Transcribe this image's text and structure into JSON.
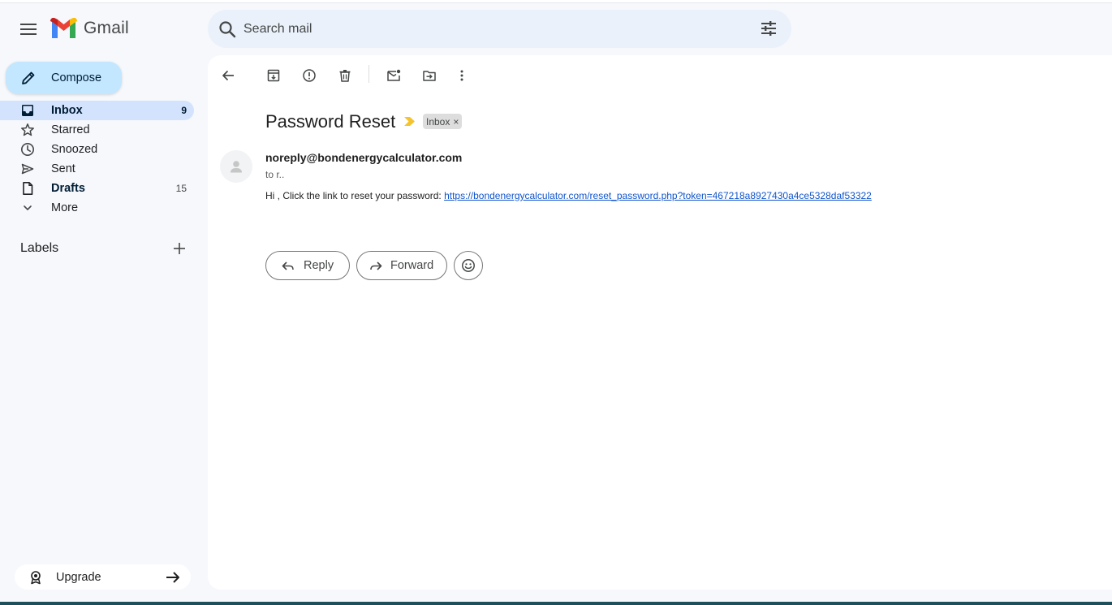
{
  "app": {
    "name": "Gmail",
    "colors": {
      "accent": "#c2e7ff",
      "nav_active": "#d3e3fd",
      "link": "#1155cc",
      "importance": "#f4c430"
    }
  },
  "header": {
    "menu_icon": "hamburger-menu-icon",
    "logo_text": "Gmail",
    "search": {
      "placeholder": "Search mail",
      "value": ""
    }
  },
  "sidebar": {
    "compose_label": "Compose",
    "items": [
      {
        "label": "Inbox",
        "count": "9",
        "icon": "inbox-icon"
      },
      {
        "label": "Starred",
        "count": "",
        "icon": "star-icon"
      },
      {
        "label": "Snoozed",
        "count": "",
        "icon": "clock-icon"
      },
      {
        "label": "Sent",
        "count": "",
        "icon": "send-icon"
      },
      {
        "label": "Drafts",
        "count": "15",
        "icon": "draft-icon"
      },
      {
        "label": "More",
        "count": "",
        "icon": "chevron-down-icon"
      }
    ],
    "labels_heading": "Labels",
    "upgrade_label": "Upgrade"
  },
  "message": {
    "subject": "Password Reset",
    "chip_label": "Inbox",
    "chip_close": "×",
    "sender": "noreply@bondenergycalculator.com",
    "to": "to r..",
    "body_greeting": "Hi ",
    "body_name": "",
    "body_text": ", Click the link to reset your password: ",
    "body_link": "https://bondenergycalculator.com/reset_password.php?token=467218a8927430a4ce5328daf53322",
    "reply_label": "Reply",
    "forward_label": "Forward"
  }
}
